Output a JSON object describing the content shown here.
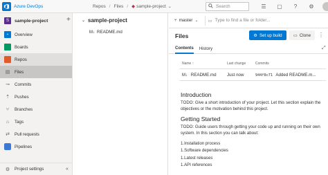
{
  "header": {
    "brand": "Azure DevOps",
    "breadcrumb": [
      "Repos",
      "Files",
      "sample-project"
    ],
    "search_placeholder": "Search"
  },
  "sidebar": {
    "project_badge": "S",
    "project_name": "sample-project",
    "items": [
      {
        "label": "Overview"
      },
      {
        "label": "Boards"
      },
      {
        "label": "Repos"
      },
      {
        "label": "Files"
      },
      {
        "label": "Commits"
      },
      {
        "label": "Pushes"
      },
      {
        "label": "Branches"
      },
      {
        "label": "Tags"
      },
      {
        "label": "Pull requests"
      },
      {
        "label": "Pipelines"
      }
    ],
    "settings_label": "Project settings"
  },
  "tree": {
    "repo_name": "sample-project",
    "file_icon": "M↓",
    "file_name": "README.md"
  },
  "main": {
    "branch": "master",
    "path_placeholder": "Type to find a file or folder...",
    "title": "Files",
    "setup_build_label": "Set up build",
    "clone_label": "Clone",
    "tabs": [
      "Contents",
      "History"
    ],
    "table": {
      "headers": [
        "Name ↑",
        "Last change",
        "Commits"
      ],
      "row": {
        "name": "README.md",
        "last_change": "Just now",
        "hash": "944f8c71",
        "message": "Added README.m..."
      }
    },
    "readme": {
      "h1": "Introduction",
      "p1": "TODO: Give a short introduction of your project. Let this section explain the objectives or the motivation behind this project.",
      "h2": "Getting Started",
      "p2": "TODO: Guide users through getting your code up and running on their own system. In this section you can talk about:",
      "list": [
        "Installation process",
        "Software dependencies",
        "Latest releases",
        "API references"
      ]
    }
  },
  "colors": {
    "accent": "#0078d4",
    "project_badge": "#5c2d91",
    "repos": "#e05b2a",
    "boards": "#009966"
  }
}
